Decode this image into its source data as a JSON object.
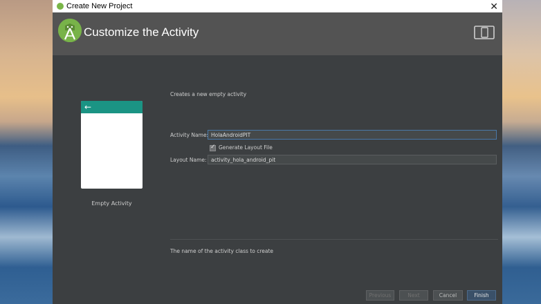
{
  "window": {
    "title": "Create New Project",
    "close_glyph": "✕"
  },
  "header": {
    "title": "Customize the Activity",
    "icon": "android-studio-logo",
    "device_icon": "phone-tablet-icon"
  },
  "preview": {
    "label": "Empty Activity",
    "back_glyph": "←",
    "appbar_color": "#1b9484"
  },
  "form": {
    "description": "Creates a new empty activity",
    "activity_name_label": "Activity Name:",
    "activity_name_value": "HolaAndroidPIT",
    "generate_layout_label": "Generate Layout File",
    "generate_layout_checked": true,
    "layout_name_label": "Layout Name:",
    "layout_name_value": "activity_hola_android_pit",
    "hint": "The name of the activity class to create"
  },
  "buttons": {
    "previous": "Previous",
    "next": "Next",
    "cancel": "Cancel",
    "finish": "Finish"
  },
  "colors": {
    "dialog_bg": "#3c3f41",
    "header_bg": "#535353",
    "accent": "#4a79a8"
  }
}
